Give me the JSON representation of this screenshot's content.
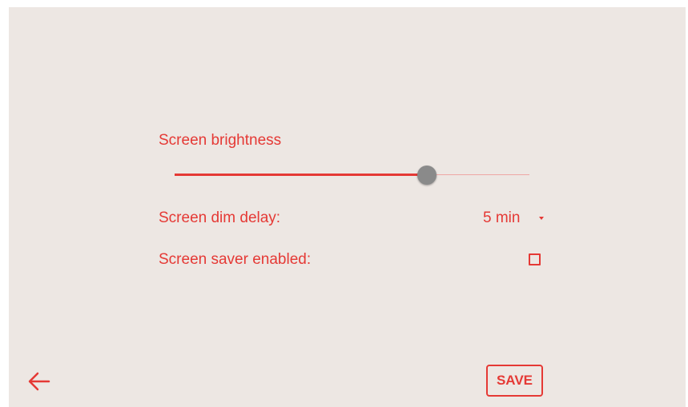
{
  "settings": {
    "brightness": {
      "label": "Screen brightness",
      "value_fraction": 0.71
    },
    "dim_delay": {
      "label": "Screen dim delay:",
      "value": "5 min"
    },
    "screen_saver": {
      "label": "Screen saver enabled:",
      "checked": false
    }
  },
  "footer": {
    "back_icon": "arrow-left-icon",
    "save_label": "SAVE"
  },
  "colors": {
    "accent": "#e53935",
    "background": "#ede7e3",
    "thumb": "#8a8a8a"
  }
}
